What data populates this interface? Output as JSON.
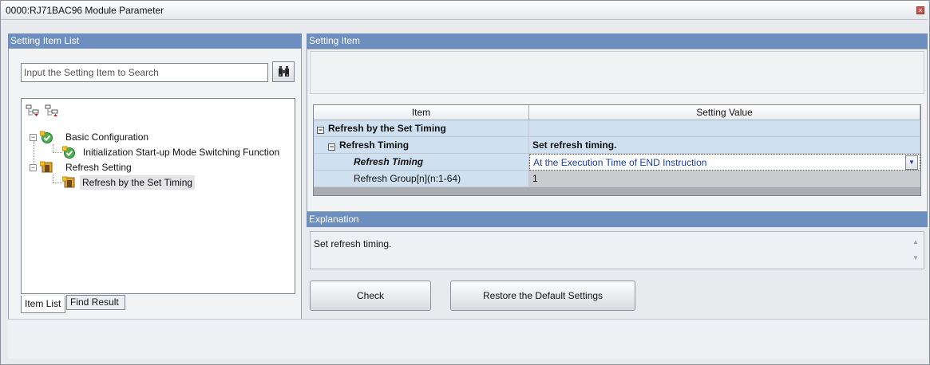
{
  "window": {
    "title": "0000:RJ71BAC96 Module Parameter",
    "close_icon": "close-icon"
  },
  "left_pane": {
    "header": "Setting Item List",
    "search_placeholder": "Input the Setting Item to Search",
    "search_icon": "binoculars-icon",
    "tree": [
      {
        "label": "Basic Configuration",
        "icon": "check-icon",
        "level": 0
      },
      {
        "label": "Initialization Start-up Mode Switching Function",
        "icon": "check-icon",
        "level": 1
      },
      {
        "label": "Refresh Setting",
        "icon": "refresh-setting-icon",
        "level": 0
      },
      {
        "label": "Refresh by the Set Timing",
        "icon": "refresh-setting-icon",
        "level": 1,
        "selected": true
      }
    ],
    "tabs": [
      {
        "label": "Item List",
        "active": true
      },
      {
        "label": "Find Result",
        "active": false
      }
    ]
  },
  "right_pane": {
    "header": "Setting Item",
    "grid": {
      "columns": [
        "Item",
        "Setting Value"
      ],
      "rows": [
        {
          "item": "Refresh by the Set Timing",
          "value": ""
        },
        {
          "item": "Refresh Timing",
          "value": "Set refresh timing."
        },
        {
          "item": "Refresh Timing",
          "value": "At the Execution Time of END Instruction"
        },
        {
          "item": "Refresh Group[n](n:1-64)",
          "value": "1"
        }
      ]
    },
    "explanation_header": "Explanation",
    "explanation_text": "Set refresh timing.",
    "buttons": {
      "check": "Check",
      "restore": "Restore the Default Settings"
    }
  },
  "colors": {
    "header_blue": "#6c8fc0",
    "row_blue": "#cfe0f1",
    "selected_value_text": "#1a3fa0"
  }
}
